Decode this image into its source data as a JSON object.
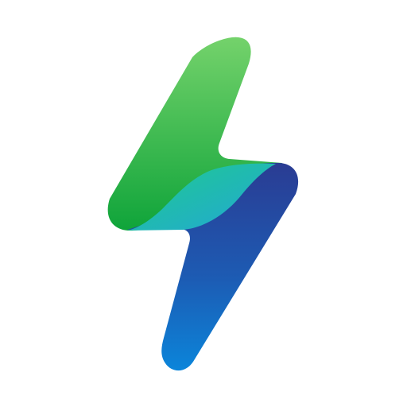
{
  "logo": {
    "icon": "lightning-bolt-icon",
    "colors": {
      "background": "#ffffff",
      "green_top": "#74D26B",
      "green_bottom": "#0FA43A",
      "teal_top": "#1FCB8E",
      "teal_bottom": "#22A7D6",
      "blue_top": "#2A3C93",
      "blue_bottom": "#0B85DA"
    }
  }
}
